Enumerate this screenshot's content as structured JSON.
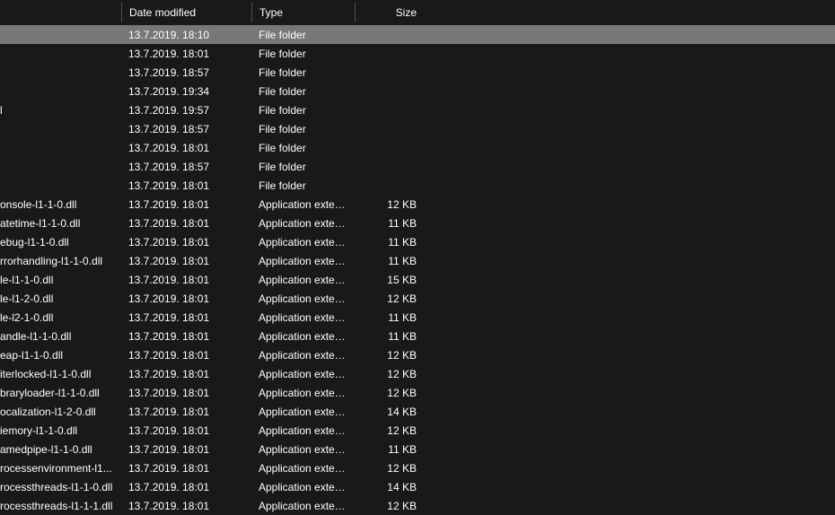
{
  "columns": {
    "name": "",
    "date": "Date modified",
    "type": "Type",
    "size": "Size"
  },
  "rows": [
    {
      "name": "",
      "date": "13.7.2019. 18:10",
      "type": "File folder",
      "size": "",
      "selected": true
    },
    {
      "name": "",
      "date": "13.7.2019. 18:01",
      "type": "File folder",
      "size": ""
    },
    {
      "name": "",
      "date": "13.7.2019. 18:57",
      "type": "File folder",
      "size": ""
    },
    {
      "name": "",
      "date": "13.7.2019. 19:34",
      "type": "File folder",
      "size": ""
    },
    {
      "name": "l",
      "date": "13.7.2019. 19:57",
      "type": "File folder",
      "size": ""
    },
    {
      "name": "",
      "date": "13.7.2019. 18:57",
      "type": "File folder",
      "size": ""
    },
    {
      "name": "",
      "date": "13.7.2019. 18:01",
      "type": "File folder",
      "size": ""
    },
    {
      "name": "",
      "date": "13.7.2019. 18:57",
      "type": "File folder",
      "size": ""
    },
    {
      "name": "",
      "date": "13.7.2019. 18:01",
      "type": "File folder",
      "size": ""
    },
    {
      "name": "onsole-l1-1-0.dll",
      "date": "13.7.2019. 18:01",
      "type": "Application exten...",
      "size": "12 KB"
    },
    {
      "name": "atetime-l1-1-0.dll",
      "date": "13.7.2019. 18:01",
      "type": "Application exten...",
      "size": "11 KB"
    },
    {
      "name": "ebug-l1-1-0.dll",
      "date": "13.7.2019. 18:01",
      "type": "Application exten...",
      "size": "11 KB"
    },
    {
      "name": "rrorhandling-l1-1-0.dll",
      "date": "13.7.2019. 18:01",
      "type": "Application exten...",
      "size": "11 KB"
    },
    {
      "name": "le-l1-1-0.dll",
      "date": "13.7.2019. 18:01",
      "type": "Application exten...",
      "size": "15 KB"
    },
    {
      "name": "le-l1-2-0.dll",
      "date": "13.7.2019. 18:01",
      "type": "Application exten...",
      "size": "12 KB"
    },
    {
      "name": "le-l2-1-0.dll",
      "date": "13.7.2019. 18:01",
      "type": "Application exten...",
      "size": "11 KB"
    },
    {
      "name": "andle-l1-1-0.dll",
      "date": "13.7.2019. 18:01",
      "type": "Application exten...",
      "size": "11 KB"
    },
    {
      "name": "eap-l1-1-0.dll",
      "date": "13.7.2019. 18:01",
      "type": "Application exten...",
      "size": "12 KB"
    },
    {
      "name": "iterlocked-l1-1-0.dll",
      "date": "13.7.2019. 18:01",
      "type": "Application exten...",
      "size": "12 KB"
    },
    {
      "name": "braryloader-l1-1-0.dll",
      "date": "13.7.2019. 18:01",
      "type": "Application exten...",
      "size": "12 KB"
    },
    {
      "name": "ocalization-l1-2-0.dll",
      "date": "13.7.2019. 18:01",
      "type": "Application exten...",
      "size": "14 KB"
    },
    {
      "name": "iemory-l1-1-0.dll",
      "date": "13.7.2019. 18:01",
      "type": "Application exten...",
      "size": "12 KB"
    },
    {
      "name": "amedpipe-l1-1-0.dll",
      "date": "13.7.2019. 18:01",
      "type": "Application exten...",
      "size": "11 KB"
    },
    {
      "name": "rocessenvironment-l1...",
      "date": "13.7.2019. 18:01",
      "type": "Application exten...",
      "size": "12 KB"
    },
    {
      "name": "rocessthreads-l1-1-0.dll",
      "date": "13.7.2019. 18:01",
      "type": "Application exten...",
      "size": "14 KB"
    },
    {
      "name": "rocessthreads-l1-1-1.dll",
      "date": "13.7.2019. 18:01",
      "type": "Application exten...",
      "size": "12 KB"
    }
  ]
}
